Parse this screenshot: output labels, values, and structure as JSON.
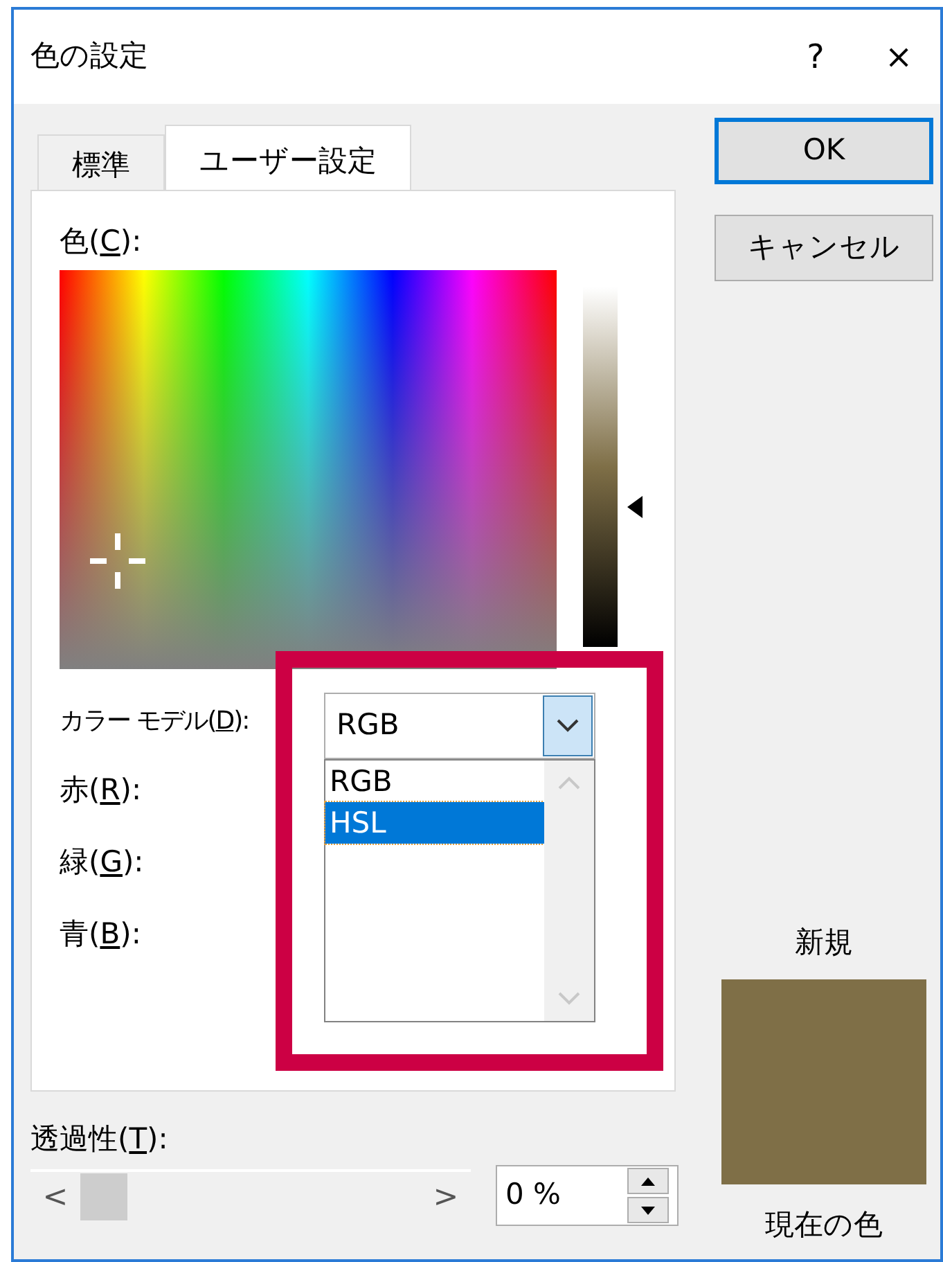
{
  "window": {
    "title": "色の設定",
    "help": "?",
    "close": "×"
  },
  "tabs": [
    {
      "label": "標準",
      "selected": false
    },
    {
      "label": "ユーザー設定",
      "selected": true
    }
  ],
  "buttons": [
    {
      "label": "OK",
      "default": true
    },
    {
      "label": "キャンセル",
      "default": false
    }
  ],
  "color_label": {
    "before": "色(",
    "key": "C",
    "after": "):"
  },
  "luminance": {
    "level": 0.39
  },
  "color_model": {
    "label": {
      "before": "カラー モデル(",
      "key": "D",
      "after": "):"
    },
    "value": "RGB",
    "expanded": true,
    "options": [
      {
        "label": "RGB",
        "highlighted": false
      },
      {
        "label": "HSL",
        "highlighted": true
      }
    ]
  },
  "channels": [
    {
      "before": "赤(",
      "key": "R",
      "after": "):"
    },
    {
      "before": "緑(",
      "key": "G",
      "after": "):"
    },
    {
      "before": "青(",
      "key": "B",
      "after": "):"
    }
  ],
  "transparency": {
    "label": {
      "before": "透過性(",
      "key": "T",
      "after": "):"
    },
    "value": "0 %",
    "decrement": "<",
    "increment": ">"
  },
  "new_label": "新規",
  "current_label": "現在の色",
  "highlight_frame": true
}
